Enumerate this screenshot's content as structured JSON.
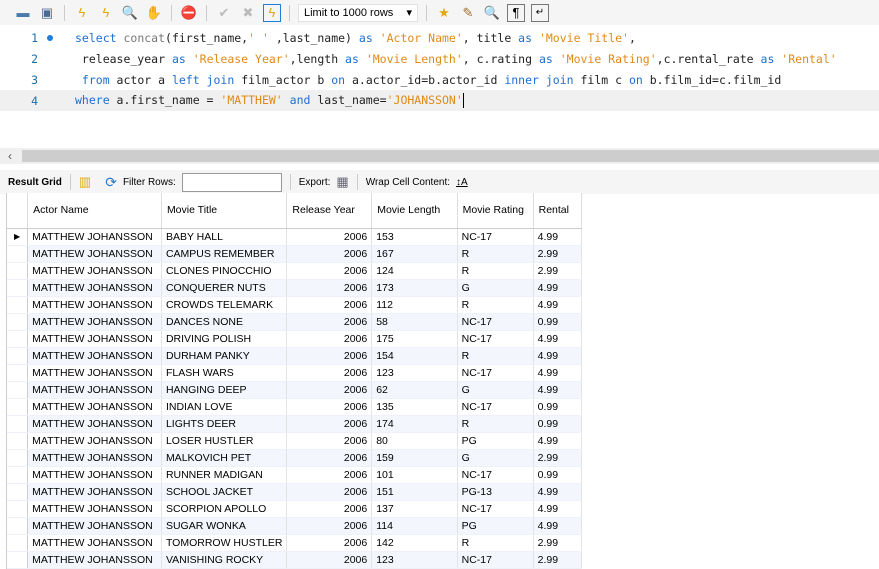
{
  "toolbar": {
    "icons": [
      "open-folder-icon",
      "save-icon",
      "execute-icon",
      "execute-current-icon",
      "explain-icon",
      "stop-icon",
      "toggle-error-stop-icon",
      "commit-icon",
      "rollback-icon",
      "autocommit-icon",
      "add-snippet-icon",
      "beautify-icon",
      "find-icon",
      "invisible-chars-icon",
      "word-wrap-icon"
    ],
    "limit": "Limit to 1000 rows"
  },
  "editor": {
    "lines": [
      {
        "num": "1",
        "tokens": [
          [
            "kw",
            "select "
          ],
          [
            "fn",
            "concat"
          ],
          [
            "id",
            "(first_name,"
          ],
          [
            "str",
            "' '"
          ],
          [
            "id",
            " ,last_name) "
          ],
          [
            "kw",
            "as "
          ],
          [
            "str",
            "'Actor Name'"
          ],
          [
            "id",
            ", title "
          ],
          [
            "kw",
            "as "
          ],
          [
            "str",
            "'Movie Title'"
          ],
          [
            "id",
            ","
          ]
        ]
      },
      {
        "num": "2",
        "tokens": [
          [
            "id",
            " release_year "
          ],
          [
            "kw",
            "as "
          ],
          [
            "str",
            "'Release Year'"
          ],
          [
            "id",
            ",length "
          ],
          [
            "kw",
            "as "
          ],
          [
            "str",
            "'Movie Length'"
          ],
          [
            "id",
            ", c.rating "
          ],
          [
            "kw",
            "as "
          ],
          [
            "str",
            "'Movie Rating'"
          ],
          [
            "id",
            ",c.rental_rate "
          ],
          [
            "kw",
            "as "
          ],
          [
            "str",
            "'Rental'"
          ]
        ]
      },
      {
        "num": "3",
        "tokens": [
          [
            "kw",
            " from "
          ],
          [
            "id",
            "actor a "
          ],
          [
            "kw",
            "left join "
          ],
          [
            "id",
            "film_actor b "
          ],
          [
            "kw",
            "on "
          ],
          [
            "id",
            "a.actor_id=b.actor_id "
          ],
          [
            "kw",
            "inner join "
          ],
          [
            "id",
            "film c "
          ],
          [
            "kw",
            "on "
          ],
          [
            "id",
            "b.film_id=c.film_id"
          ]
        ]
      },
      {
        "num": "4",
        "tokens": [
          [
            "kw",
            "where "
          ],
          [
            "id",
            "a.first_name = "
          ],
          [
            "str",
            "'MATTHEW'"
          ],
          [
            "kw",
            " and "
          ],
          [
            "id",
            "last_name="
          ],
          [
            "str",
            "'JOHANSSON'"
          ]
        ]
      }
    ]
  },
  "results": {
    "result_grid": "Result Grid",
    "filter_rows": "Filter Rows:",
    "filter_value": "",
    "export": "Export:",
    "wrap": "Wrap Cell Content:",
    "columns": [
      "Actor Name",
      "Movie Title",
      "Release Year",
      "Movie Length",
      "Movie Rating",
      "Rental"
    ],
    "rows": [
      [
        "MATTHEW JOHANSSON",
        "BABY HALL",
        "2006",
        "153",
        "NC-17",
        "4.99"
      ],
      [
        "MATTHEW JOHANSSON",
        "CAMPUS REMEMBER",
        "2006",
        "167",
        "R",
        "2.99"
      ],
      [
        "MATTHEW JOHANSSON",
        "CLONES PINOCCHIO",
        "2006",
        "124",
        "R",
        "2.99"
      ],
      [
        "MATTHEW JOHANSSON",
        "CONQUERER NUTS",
        "2006",
        "173",
        "G",
        "4.99"
      ],
      [
        "MATTHEW JOHANSSON",
        "CROWDS TELEMARK",
        "2006",
        "112",
        "R",
        "4.99"
      ],
      [
        "MATTHEW JOHANSSON",
        "DANCES NONE",
        "2006",
        "58",
        "NC-17",
        "0.99"
      ],
      [
        "MATTHEW JOHANSSON",
        "DRIVING POLISH",
        "2006",
        "175",
        "NC-17",
        "4.99"
      ],
      [
        "MATTHEW JOHANSSON",
        "DURHAM PANKY",
        "2006",
        "154",
        "R",
        "4.99"
      ],
      [
        "MATTHEW JOHANSSON",
        "FLASH WARS",
        "2006",
        "123",
        "NC-17",
        "4.99"
      ],
      [
        "MATTHEW JOHANSSON",
        "HANGING DEEP",
        "2006",
        "62",
        "G",
        "4.99"
      ],
      [
        "MATTHEW JOHANSSON",
        "INDIAN LOVE",
        "2006",
        "135",
        "NC-17",
        "0.99"
      ],
      [
        "MATTHEW JOHANSSON",
        "LIGHTS DEER",
        "2006",
        "174",
        "R",
        "0.99"
      ],
      [
        "MATTHEW JOHANSSON",
        "LOSER HUSTLER",
        "2006",
        "80",
        "PG",
        "4.99"
      ],
      [
        "MATTHEW JOHANSSON",
        "MALKOVICH PET",
        "2006",
        "159",
        "G",
        "2.99"
      ],
      [
        "MATTHEW JOHANSSON",
        "RUNNER MADIGAN",
        "2006",
        "101",
        "NC-17",
        "0.99"
      ],
      [
        "MATTHEW JOHANSSON",
        "SCHOOL JACKET",
        "2006",
        "151",
        "PG-13",
        "4.99"
      ],
      [
        "MATTHEW JOHANSSON",
        "SCORPION APOLLO",
        "2006",
        "137",
        "NC-17",
        "4.99"
      ],
      [
        "MATTHEW JOHANSSON",
        "SUGAR WONKA",
        "2006",
        "114",
        "PG",
        "4.99"
      ],
      [
        "MATTHEW JOHANSSON",
        "TOMORROW HUSTLER",
        "2006",
        "142",
        "R",
        "2.99"
      ],
      [
        "MATTHEW JOHANSSON",
        "VANISHING ROCKY",
        "2006",
        "123",
        "NC-17",
        "2.99"
      ]
    ]
  }
}
